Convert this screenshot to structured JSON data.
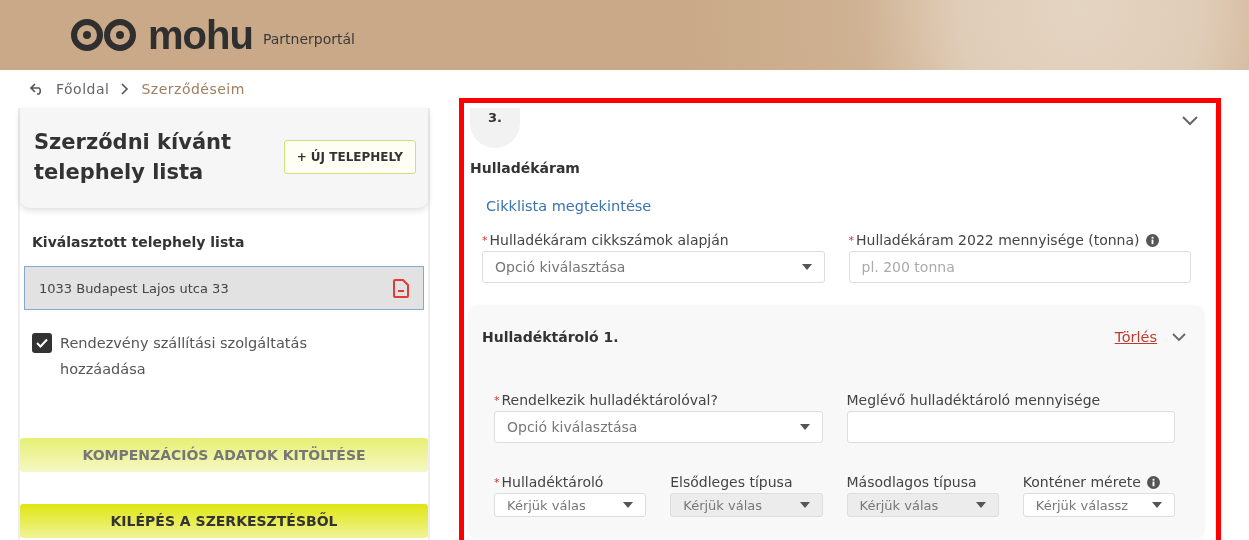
{
  "header": {
    "logo": "mohu",
    "subtitle": "Partnerportál"
  },
  "breadcrumb": [
    {
      "label": "Főoldal",
      "selected": false
    },
    {
      "label": "Szerződéseim",
      "selected": true
    }
  ],
  "left": {
    "title": "Szerződni kívánt telephely lista",
    "add_button": "+ ÚJ TELEPHELY",
    "selected_heading": "Kiválasztott telephely lista",
    "sites": [
      "1033 Budapest Lajos utca 33"
    ],
    "event_option": {
      "label": "Rendezvény szállítási szolgáltatás hozzáadása",
      "checked": true
    },
    "buttons": [
      {
        "label": "KOMPENZÁCIÓS ADATOK KITÖLTÉSE",
        "disabled": true
      },
      {
        "label": "KILÉPÉS A SZERKESZTÉSBŐL",
        "disabled": false
      }
    ]
  },
  "step": {
    "number": "3.",
    "expanded": true,
    "title": "Hulladékáram",
    "link": "Cikklista megtekintése",
    "fields": [
      {
        "marker": "*",
        "label": "Hulladékáram cikkszámok alapján",
        "kind": "select",
        "placeholder": "Opció kiválasztása",
        "disabled": false
      },
      {
        "marker": "*",
        "label": "Hulladékáram 2022 mennyisége (tonna)",
        "kind": "input",
        "placeholder": "pl. 200 tonna",
        "info": true,
        "disabled": false
      }
    ]
  },
  "container": {
    "title": "Hulladéktároló 1.",
    "delete": "Törlés",
    "expanded": true,
    "fields": [
      {
        "marker": "*",
        "label": "Rendelkezik hulladéktárolóval?",
        "kind": "select",
        "placeholder": "Opció kiválasztása",
        "disabled": false
      },
      {
        "label": "Meglévő hulladéktároló mennyisége",
        "kind": "input",
        "disabled": false
      }
    ],
    "type_fields": [
      {
        "marker": "*",
        "label": "Hulladéktároló",
        "kind": "select",
        "placeholder": "Kérjük válas",
        "disabled": false
      },
      {
        "label": "Elsődleges típusa",
        "kind": "select",
        "placeholder": "Kérjük válas",
        "disabled": true
      },
      {
        "label": "Másodlagos típusa",
        "kind": "select",
        "placeholder": "Kérjük válas",
        "disabled": true
      },
      {
        "label": "Konténer mérete",
        "kind": "select",
        "placeholder": "Kérjük válassz",
        "info": true,
        "disabled": false
      }
    ]
  }
}
